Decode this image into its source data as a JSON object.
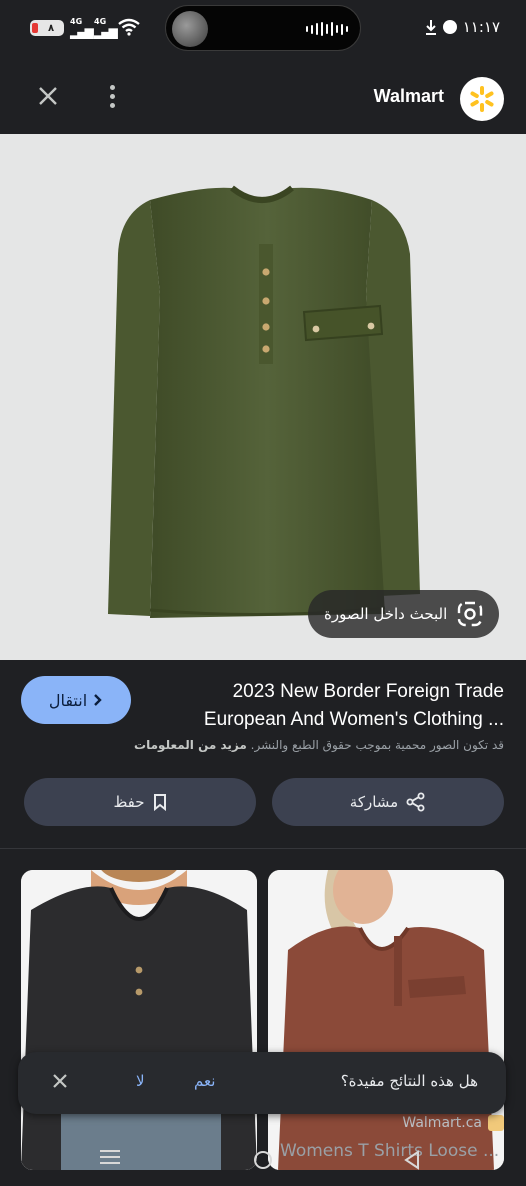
{
  "status_bar": {
    "battery": "٨",
    "net1": "4G",
    "net2": "4G",
    "time": "١١:١٧"
  },
  "header": {
    "site_name": "Walmart"
  },
  "image": {
    "search_inside_label": "البحث داخل الصورة"
  },
  "result": {
    "visit_label": "انتقال",
    "title_line1": "2023 New Border Foreign Trade",
    "title_line2": "European And Women's Clothing ...",
    "copyright_text": "قد تكون الصور محمية بموجب حقوق الطبع والنشر.",
    "learn_more": "مزيد من المعلومات",
    "save_label": "حفظ",
    "share_label": "مشاركة"
  },
  "related": {
    "source": "Walmart.ca",
    "title": "Womens T Shirts Loose ..."
  },
  "feedback": {
    "question": "هل هذه النتائج مفيدة؟",
    "yes": "نعم",
    "no": "لا"
  },
  "colors": {
    "background": "#1f2023",
    "accent": "#8ab4f8",
    "image_bg": "#e5e6e6",
    "walmart_spark": "#ffc220",
    "shirt_green": "#4e5c31",
    "shirt_black": "#2c2c2e",
    "shirt_rust": "#8b4a39"
  }
}
